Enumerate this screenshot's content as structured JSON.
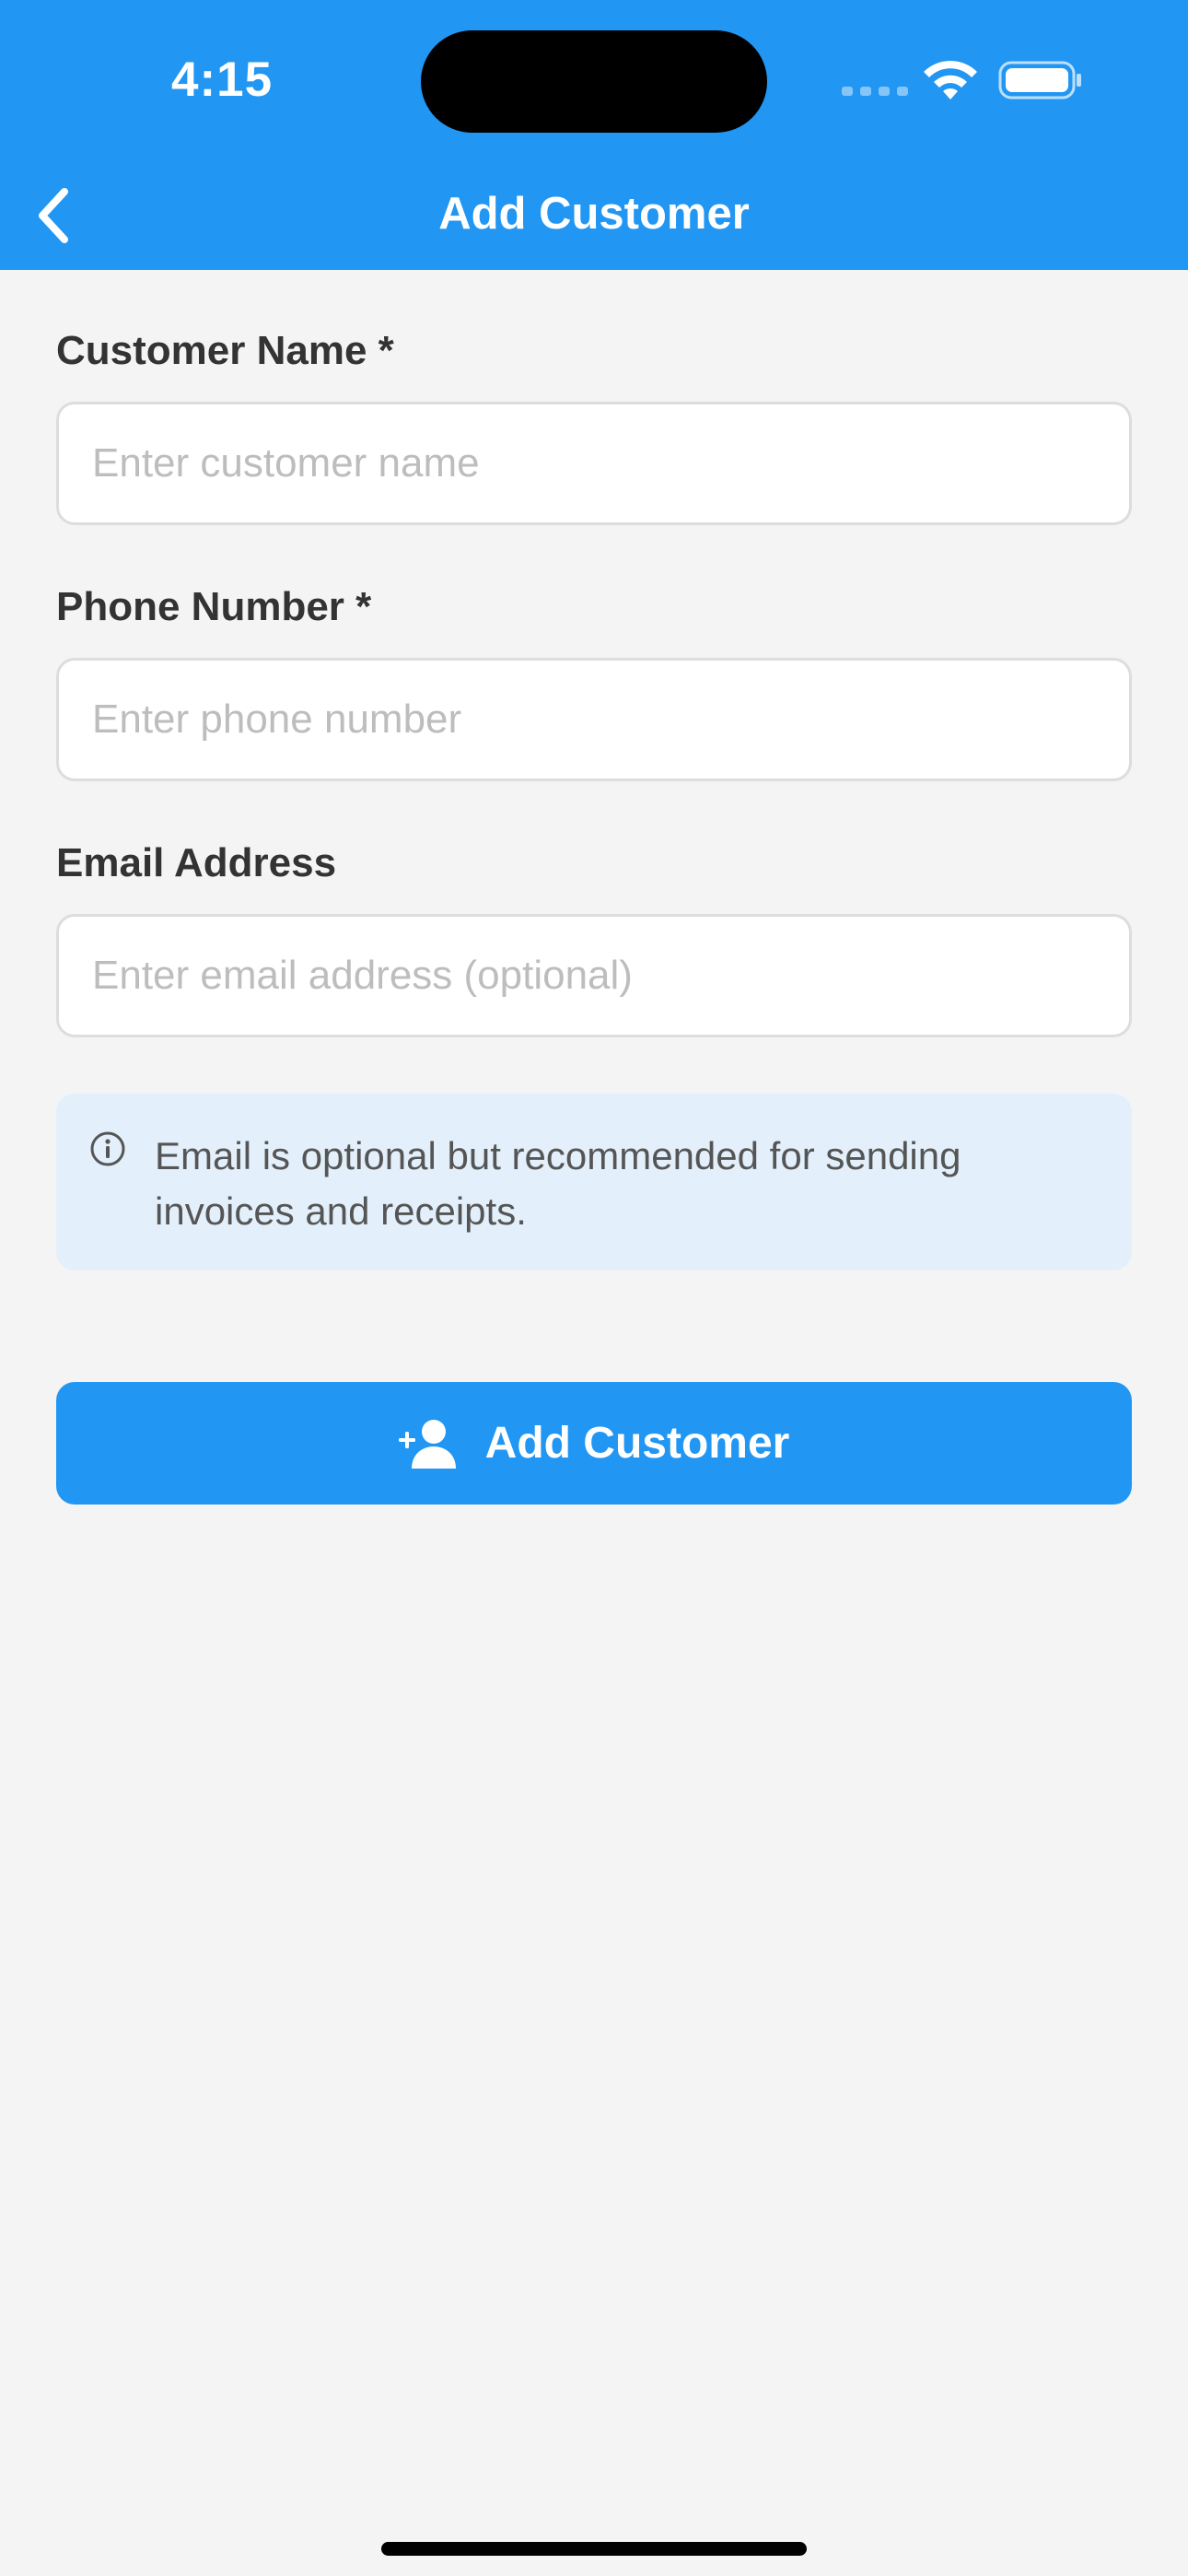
{
  "status_bar": {
    "time": "4:15"
  },
  "nav": {
    "title": "Add Customer",
    "back_icon": "chevron-left-icon"
  },
  "form": {
    "name": {
      "label": "Customer Name *",
      "placeholder": "Enter customer name",
      "value": ""
    },
    "phone": {
      "label": "Phone Number *",
      "placeholder": "Enter phone number",
      "value": ""
    },
    "email": {
      "label": "Email Address",
      "placeholder": "Enter email address (optional)",
      "value": ""
    }
  },
  "info": {
    "icon": "info-icon",
    "text": "Email is optional but recommended for sending invoices and receipts."
  },
  "submit": {
    "label": "Add Customer",
    "icon": "add-user-icon"
  },
  "colors": {
    "primary": "#2196f3",
    "background": "#f4f4f4",
    "info_background": "#e3f0fb",
    "text": "#333333",
    "placeholder": "#bdbdbd"
  }
}
